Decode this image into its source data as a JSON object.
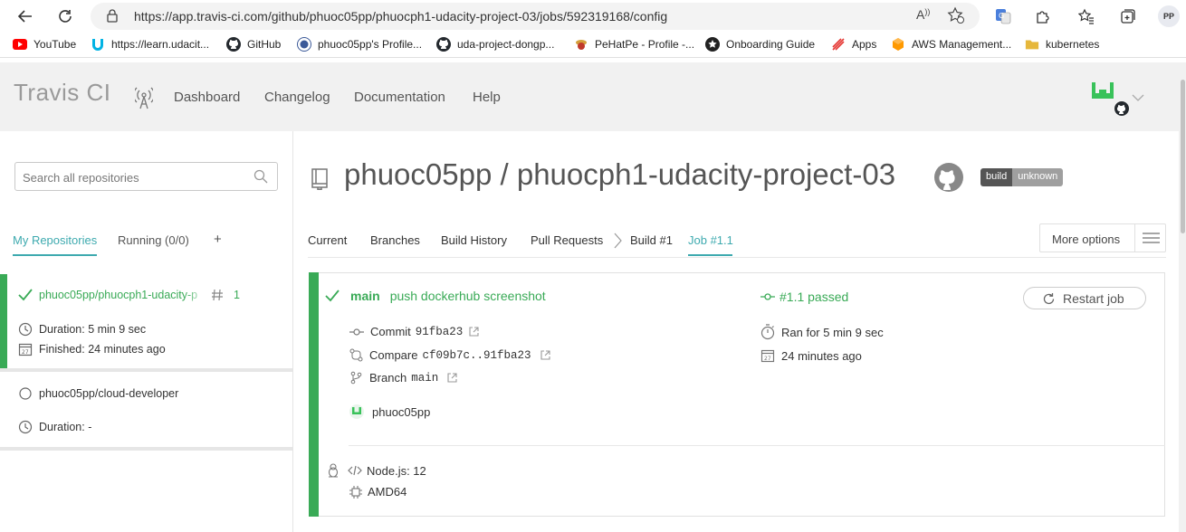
{
  "browser": {
    "url": "https://app.travis-ci.com/github/phuoc05pp/phuocph1-udacity-project-03/jobs/592319168/config",
    "profile_initials": "PP",
    "read_aloud": "A",
    "bookmarks": [
      {
        "label": "YouTube",
        "icon": "youtube-icon",
        "color": "#ff0000"
      },
      {
        "label": "https://learn.udacit...",
        "icon": "udacity-icon",
        "color": "#02b3e4"
      },
      {
        "label": "GitHub",
        "icon": "github-icon",
        "color": "#24292e"
      },
      {
        "label": "phuoc05pp's Profile...",
        "icon": "profile-icon",
        "color": "#3b5998"
      },
      {
        "label": "uda-project-dongp...",
        "icon": "github-icon",
        "color": "#24292e"
      },
      {
        "label": "PeHatPe - Profile -...",
        "icon": "pehatpe-icon",
        "color": "#c0392b"
      },
      {
        "label": "Onboarding Guide",
        "icon": "star-icon",
        "color": "#222222"
      },
      {
        "label": "Apps",
        "icon": "apps-icon",
        "color": "#e53935"
      },
      {
        "label": "AWS Management...",
        "icon": "aws-icon",
        "color": "#ff9900"
      },
      {
        "label": "kubernetes",
        "icon": "folder-icon",
        "color": "#e6b73b"
      }
    ]
  },
  "header": {
    "logo": "Travis CI",
    "nav": [
      "Dashboard",
      "Changelog",
      "Documentation",
      "Help"
    ]
  },
  "sidebar": {
    "search_placeholder": "Search all repositories",
    "tabs": [
      "My Repositories",
      "Running (0/0)",
      "+"
    ],
    "repos": [
      {
        "name": "phuoc05pp/phuocph1-udacity-p",
        "build_number": "1",
        "duration": "Duration: 5 min 9 sec",
        "finished": "Finished: 24 minutes ago",
        "status": "passed"
      },
      {
        "name": "phuoc05pp/cloud-developer",
        "duration": "Duration: -",
        "status": "none"
      }
    ]
  },
  "main": {
    "owner": "phuoc05pp",
    "separator": "/",
    "repo": "phuocph1-udacity-project-03",
    "badge": {
      "left": "build",
      "right": "unknown"
    },
    "tabs": [
      "Current",
      "Branches",
      "Build History",
      "Pull Requests",
      "Build #1",
      "Job #1.1"
    ],
    "more_options": "More options",
    "job": {
      "branch": "main",
      "message": "push dockerhub screenshot",
      "state": "#1.1 passed",
      "restart": "Restart job",
      "commit_label": "Commit",
      "commit_hash": "91fba23",
      "compare_label": "Compare",
      "compare_range": "cf09b7c..91fba23",
      "branch_label": "Branch",
      "branch_value": "main",
      "ran_for": "Ran for 5 min 9 sec",
      "ago": "24 minutes ago",
      "calendar_day": "27",
      "author": "phuoc05pp",
      "language": "Node.js: 12",
      "arch": "AMD64"
    }
  },
  "colors": {
    "accent": "#3eaaaf",
    "passed": "#39aa56",
    "header_bg": "#f1f1f1"
  }
}
